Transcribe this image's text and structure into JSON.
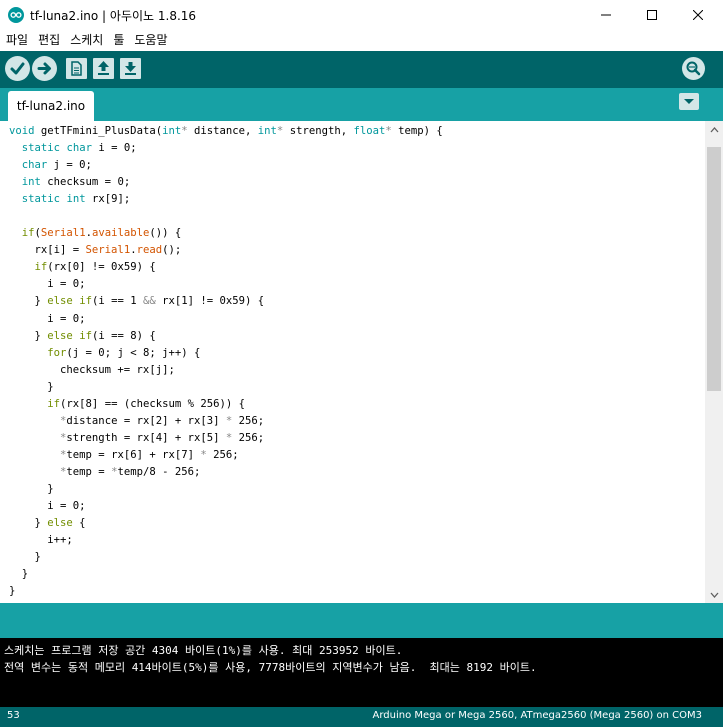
{
  "window": {
    "title": "tf-luna2.ino | 아두이노 1.8.16"
  },
  "menu": [
    "파일",
    "편집",
    "스케치",
    "툴",
    "도움말"
  ],
  "toolbar": {
    "buttons": [
      "verify-icon",
      "upload-icon",
      "new-icon",
      "open-icon",
      "save-icon"
    ],
    "serial_monitor": "serial-monitor-icon"
  },
  "tabs": [
    {
      "label": "tf-luna2.ino",
      "active": true
    }
  ],
  "editor": {
    "lines": [
      "void getTFmini_PlusData(int* distance, int* strength, float* temp) {",
      "  static char i = 0;",
      "  char j = 0;",
      "  int checksum = 0;",
      "  static int rx[9];",
      "",
      "  if(Serial1.available()) {",
      "    rx[i] = Serial1.read();",
      "    if(rx[0] != 0x59) {",
      "      i = 0;",
      "    } else if(i == 1 && rx[1] != 0x59) {",
      "      i = 0;",
      "    } else if(i == 8) {",
      "      for(j = 0; j < 8; j++) {",
      "        checksum += rx[j];",
      "      }",
      "      if(rx[8] == (checksum % 256)) {",
      "        *distance = rx[2] + rx[3] * 256;",
      "        *strength = rx[4] + rx[5] * 256;",
      "        *temp = rx[6] + rx[7] * 256;",
      "        *temp = *temp/8 - 256;",
      "      }",
      "      i = 0;",
      "    } else {",
      "      i++;",
      "    }",
      "  }",
      "}"
    ]
  },
  "console": {
    "lines": [
      "스케치는 프로그램 저장 공간 4304 바이트(1%)를 사용. 최대 253952 바이트.",
      "전역 변수는 동적 메모리 414바이트(5%)를 사용, 7778바이트의 지역변수가 남음.  최대는 8192 바이트."
    ]
  },
  "status": {
    "line_number": "53",
    "board": "Arduino Mega or Mega 2560, ATmega2560 (Mega 2560) on COM3"
  },
  "colors": {
    "toolbar": "#006468",
    "tabbar": "#17a1a5",
    "type": "#00979c",
    "builtin": "#d35400",
    "keyword": "#728e00",
    "console_bg": "#000000"
  }
}
